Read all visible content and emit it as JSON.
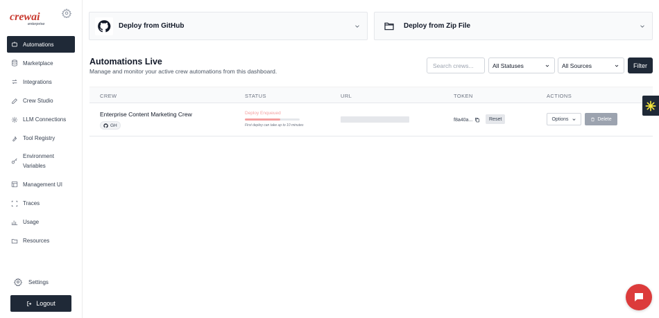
{
  "sidebar": {
    "logo_text": "crewai",
    "logo_sub": "enterprise",
    "items": [
      {
        "label": "Automations",
        "icon": "robot-icon",
        "active": true
      },
      {
        "label": "Marketplace",
        "icon": "database-icon"
      },
      {
        "label": "Integrations",
        "icon": "arrows-icon"
      },
      {
        "label": "Crew Studio",
        "icon": "pencil-icon"
      },
      {
        "label": "LLM Connections",
        "icon": "gear-icon"
      },
      {
        "label": "Tool Registry",
        "icon": "wrench-icon"
      },
      {
        "label": "Environment Variables",
        "icon": "key-icon"
      },
      {
        "label": "Management UI",
        "icon": "layout-icon"
      },
      {
        "label": "Traces",
        "icon": "scan-icon"
      },
      {
        "label": "Usage",
        "icon": "bar-chart-icon"
      },
      {
        "label": "Resources",
        "icon": "folder-icon"
      }
    ],
    "settings_label": "Settings",
    "logout_label": "Logout"
  },
  "deploy": {
    "github_label": "Deploy from GitHub",
    "zip_label": "Deploy from Zip File"
  },
  "main": {
    "title": "Automations Live",
    "subtitle": "Manage and monitor your active crew automations from this dashboard.",
    "search_placeholder": "Search crews...",
    "status_filter": "All Statuses",
    "source_filter": "All Sources",
    "filter_label": "Filter"
  },
  "table": {
    "headers": {
      "crew": "CREW",
      "status": "STATUS",
      "url": "URL",
      "token": "TOKEN",
      "actions": "ACTIONS"
    },
    "rows": [
      {
        "crew": "Enterprise Content Marketing Crew",
        "source_badge": "GH",
        "status": "Deploy Enqueued",
        "status_progress": 0.65,
        "status_note": "First deploy can take up to 10 minutes",
        "token": "f8a40a...",
        "reset_label": "Reset",
        "options_label": "Options",
        "delete_label": "Delete"
      }
    ]
  },
  "colors": {
    "dark": "#1f2937",
    "status_pending": "#f4a0a0",
    "chat_button": "#dc3b3b",
    "side_tab_icon": "#f5e63b"
  }
}
